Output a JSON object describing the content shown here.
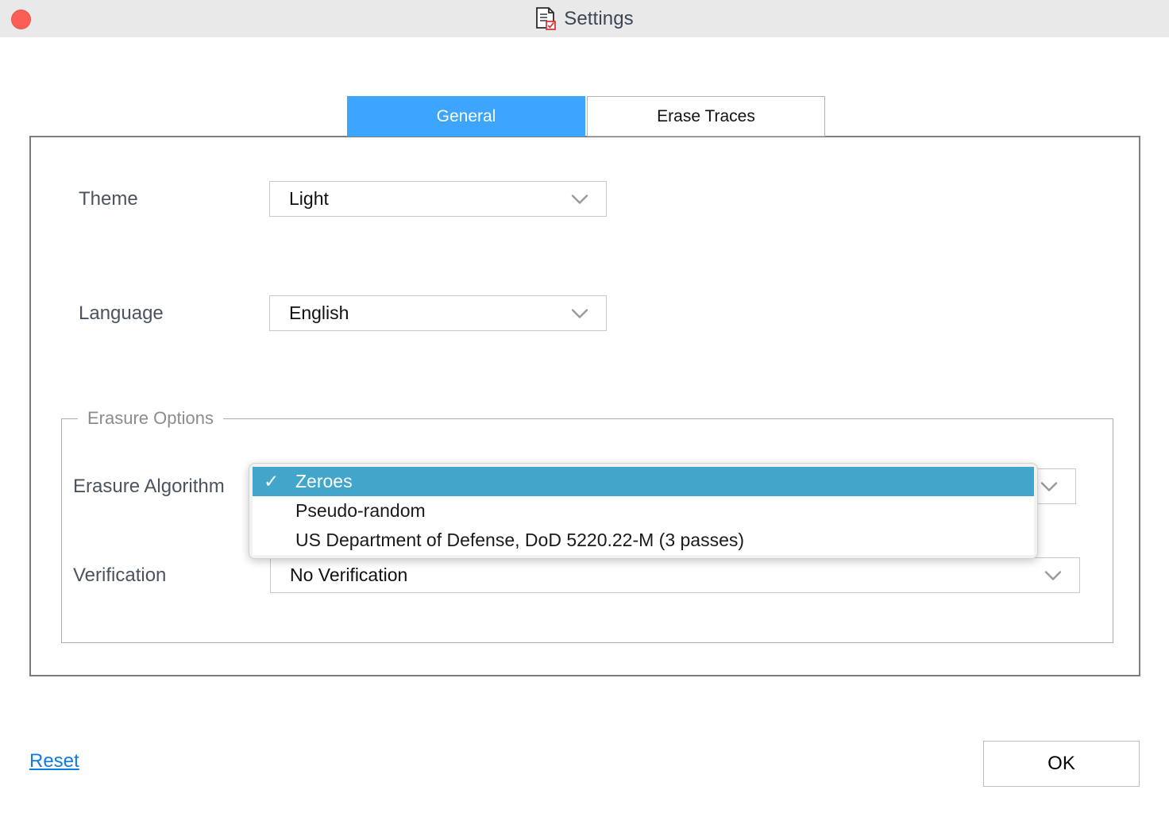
{
  "window": {
    "title": "Settings",
    "title_icon": "document-settings-icon",
    "close_button": "close-window-button",
    "titlebar_color": "#e9e9e9"
  },
  "tabs": [
    {
      "label": "General",
      "active": true
    },
    {
      "label": "Erase Traces",
      "active": false
    }
  ],
  "colors": {
    "active_tab": "#3da5fd",
    "menu_highlight": "#41a6c9",
    "link": "#0f7ce0",
    "label_text": "#4a545e",
    "close_button": "#fa5e57"
  },
  "general": {
    "theme": {
      "label": "Theme",
      "value": "Light",
      "chevron": "chevron-down-icon"
    },
    "language": {
      "label": "Language",
      "value": "English",
      "chevron": "chevron-down-icon"
    },
    "erasure_options": {
      "legend": "Erasure Options",
      "algorithm": {
        "label": "Erasure Algorithm",
        "value": "Zeroes",
        "chevron": "chevron-down-icon",
        "open": true,
        "options": [
          {
            "label": "Zeroes",
            "selected": true,
            "check": "✓"
          },
          {
            "label": "Pseudo-random",
            "selected": false,
            "check": ""
          },
          {
            "label": "US Department of Defense, DoD 5220.22-M (3 passes)",
            "selected": false,
            "check": ""
          }
        ]
      },
      "verification": {
        "label": "Verification",
        "value": "No Verification",
        "chevron": "chevron-down-icon"
      }
    }
  },
  "footer": {
    "reset_label": "Reset",
    "ok_label": "OK"
  }
}
